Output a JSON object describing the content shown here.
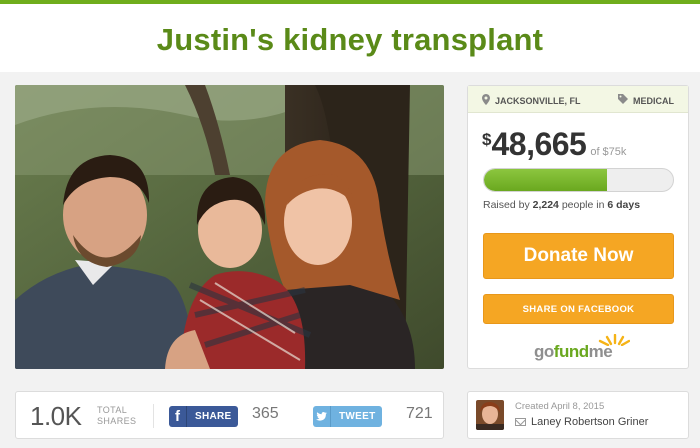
{
  "campaign": {
    "title": "Justin's kidney transplant",
    "location": "JACKSONVILLE, FL",
    "category": "MEDICAL"
  },
  "funding": {
    "currency": "$",
    "raised": "48,665",
    "of_label": "of",
    "goal": "$75k",
    "progress_fraction": 0.649,
    "raised_by_prefix": "Raised by",
    "people_count": "2,224",
    "people_suffix": "people in",
    "days": "6 days"
  },
  "actions": {
    "donate_label": "Donate Now",
    "share_facebook_label": "SHARE ON FACEBOOK"
  },
  "brand": {
    "logo_go": "go",
    "logo_fund": "fund",
    "logo_me": "me"
  },
  "shares": {
    "total": "1.0K",
    "total_label_1": "TOTAL",
    "total_label_2": "SHARES",
    "facebook_label": "SHARE",
    "facebook_count": "365",
    "tweet_label": "TWEET",
    "tweet_count": "721"
  },
  "creator": {
    "created": "Created April 8, 2015",
    "name": "Laney Robertson Griner"
  },
  "colors": {
    "brand_green": "#5a8a18",
    "accent_orange": "#f5a623",
    "facebook_blue": "#3b5998",
    "twitter_blue": "#6fb2e0"
  },
  "icons": {
    "location": "map-pin-icon",
    "category": "tag-icon",
    "facebook": "facebook-icon",
    "twitter": "twitter-bird-icon",
    "mail": "mail-icon"
  }
}
